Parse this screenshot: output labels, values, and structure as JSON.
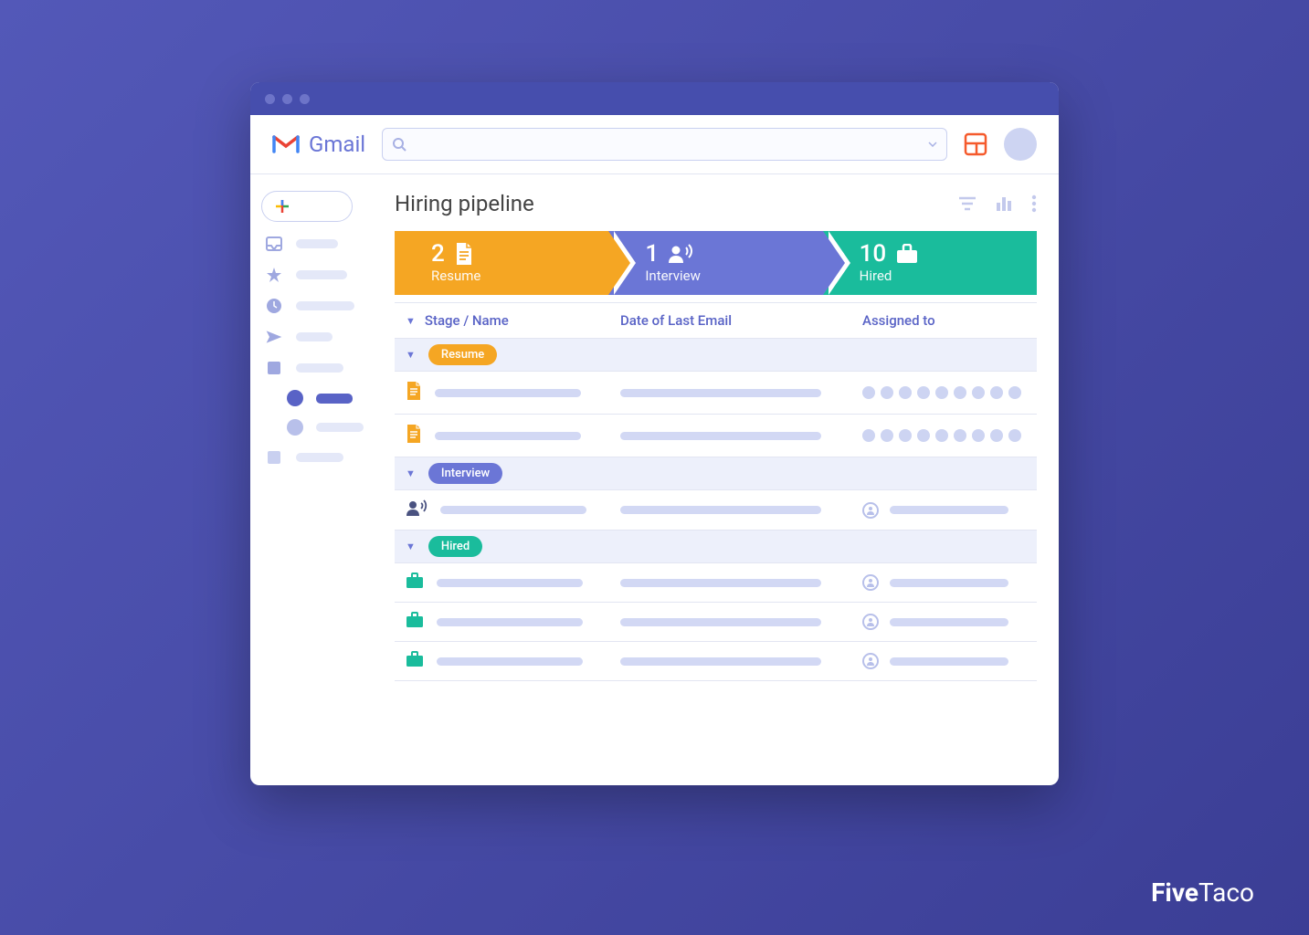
{
  "header": {
    "app_name": "Gmail",
    "search_placeholder": ""
  },
  "page": {
    "title": "Hiring pipeline"
  },
  "stages": [
    {
      "count": "2",
      "label": "Resume",
      "icon": "document-icon",
      "color": "#f5a623"
    },
    {
      "count": "1",
      "label": "Interview",
      "icon": "person-voice-icon",
      "color": "#6b76d6"
    },
    {
      "count": "10",
      "label": "Hired",
      "icon": "briefcase-icon",
      "color": "#1abc9c"
    }
  ],
  "columns": {
    "c1": "Stage / Name",
    "c2": "Date of Last Email",
    "c3": "Assigned to"
  },
  "groups": [
    {
      "label": "Resume",
      "class": "resume",
      "rows": [
        {
          "icon": "document-icon",
          "icon_color": "#f5a623",
          "assigned_type": "dots"
        },
        {
          "icon": "document-icon",
          "icon_color": "#f5a623",
          "assigned_type": "dots"
        }
      ]
    },
    {
      "label": "Interview",
      "class": "interview",
      "rows": [
        {
          "icon": "person-voice-icon",
          "icon_color": "#4a5280",
          "assigned_type": "user"
        }
      ]
    },
    {
      "label": "Hired",
      "class": "hired",
      "rows": [
        {
          "icon": "briefcase-icon",
          "icon_color": "#1abc9c",
          "assigned_type": "user"
        },
        {
          "icon": "briefcase-icon",
          "icon_color": "#1abc9c",
          "assigned_type": "user"
        },
        {
          "icon": "briefcase-icon",
          "icon_color": "#1abc9c",
          "assigned_type": "user"
        }
      ]
    }
  ],
  "branding": {
    "a": "Five",
    "b": "Taco"
  }
}
